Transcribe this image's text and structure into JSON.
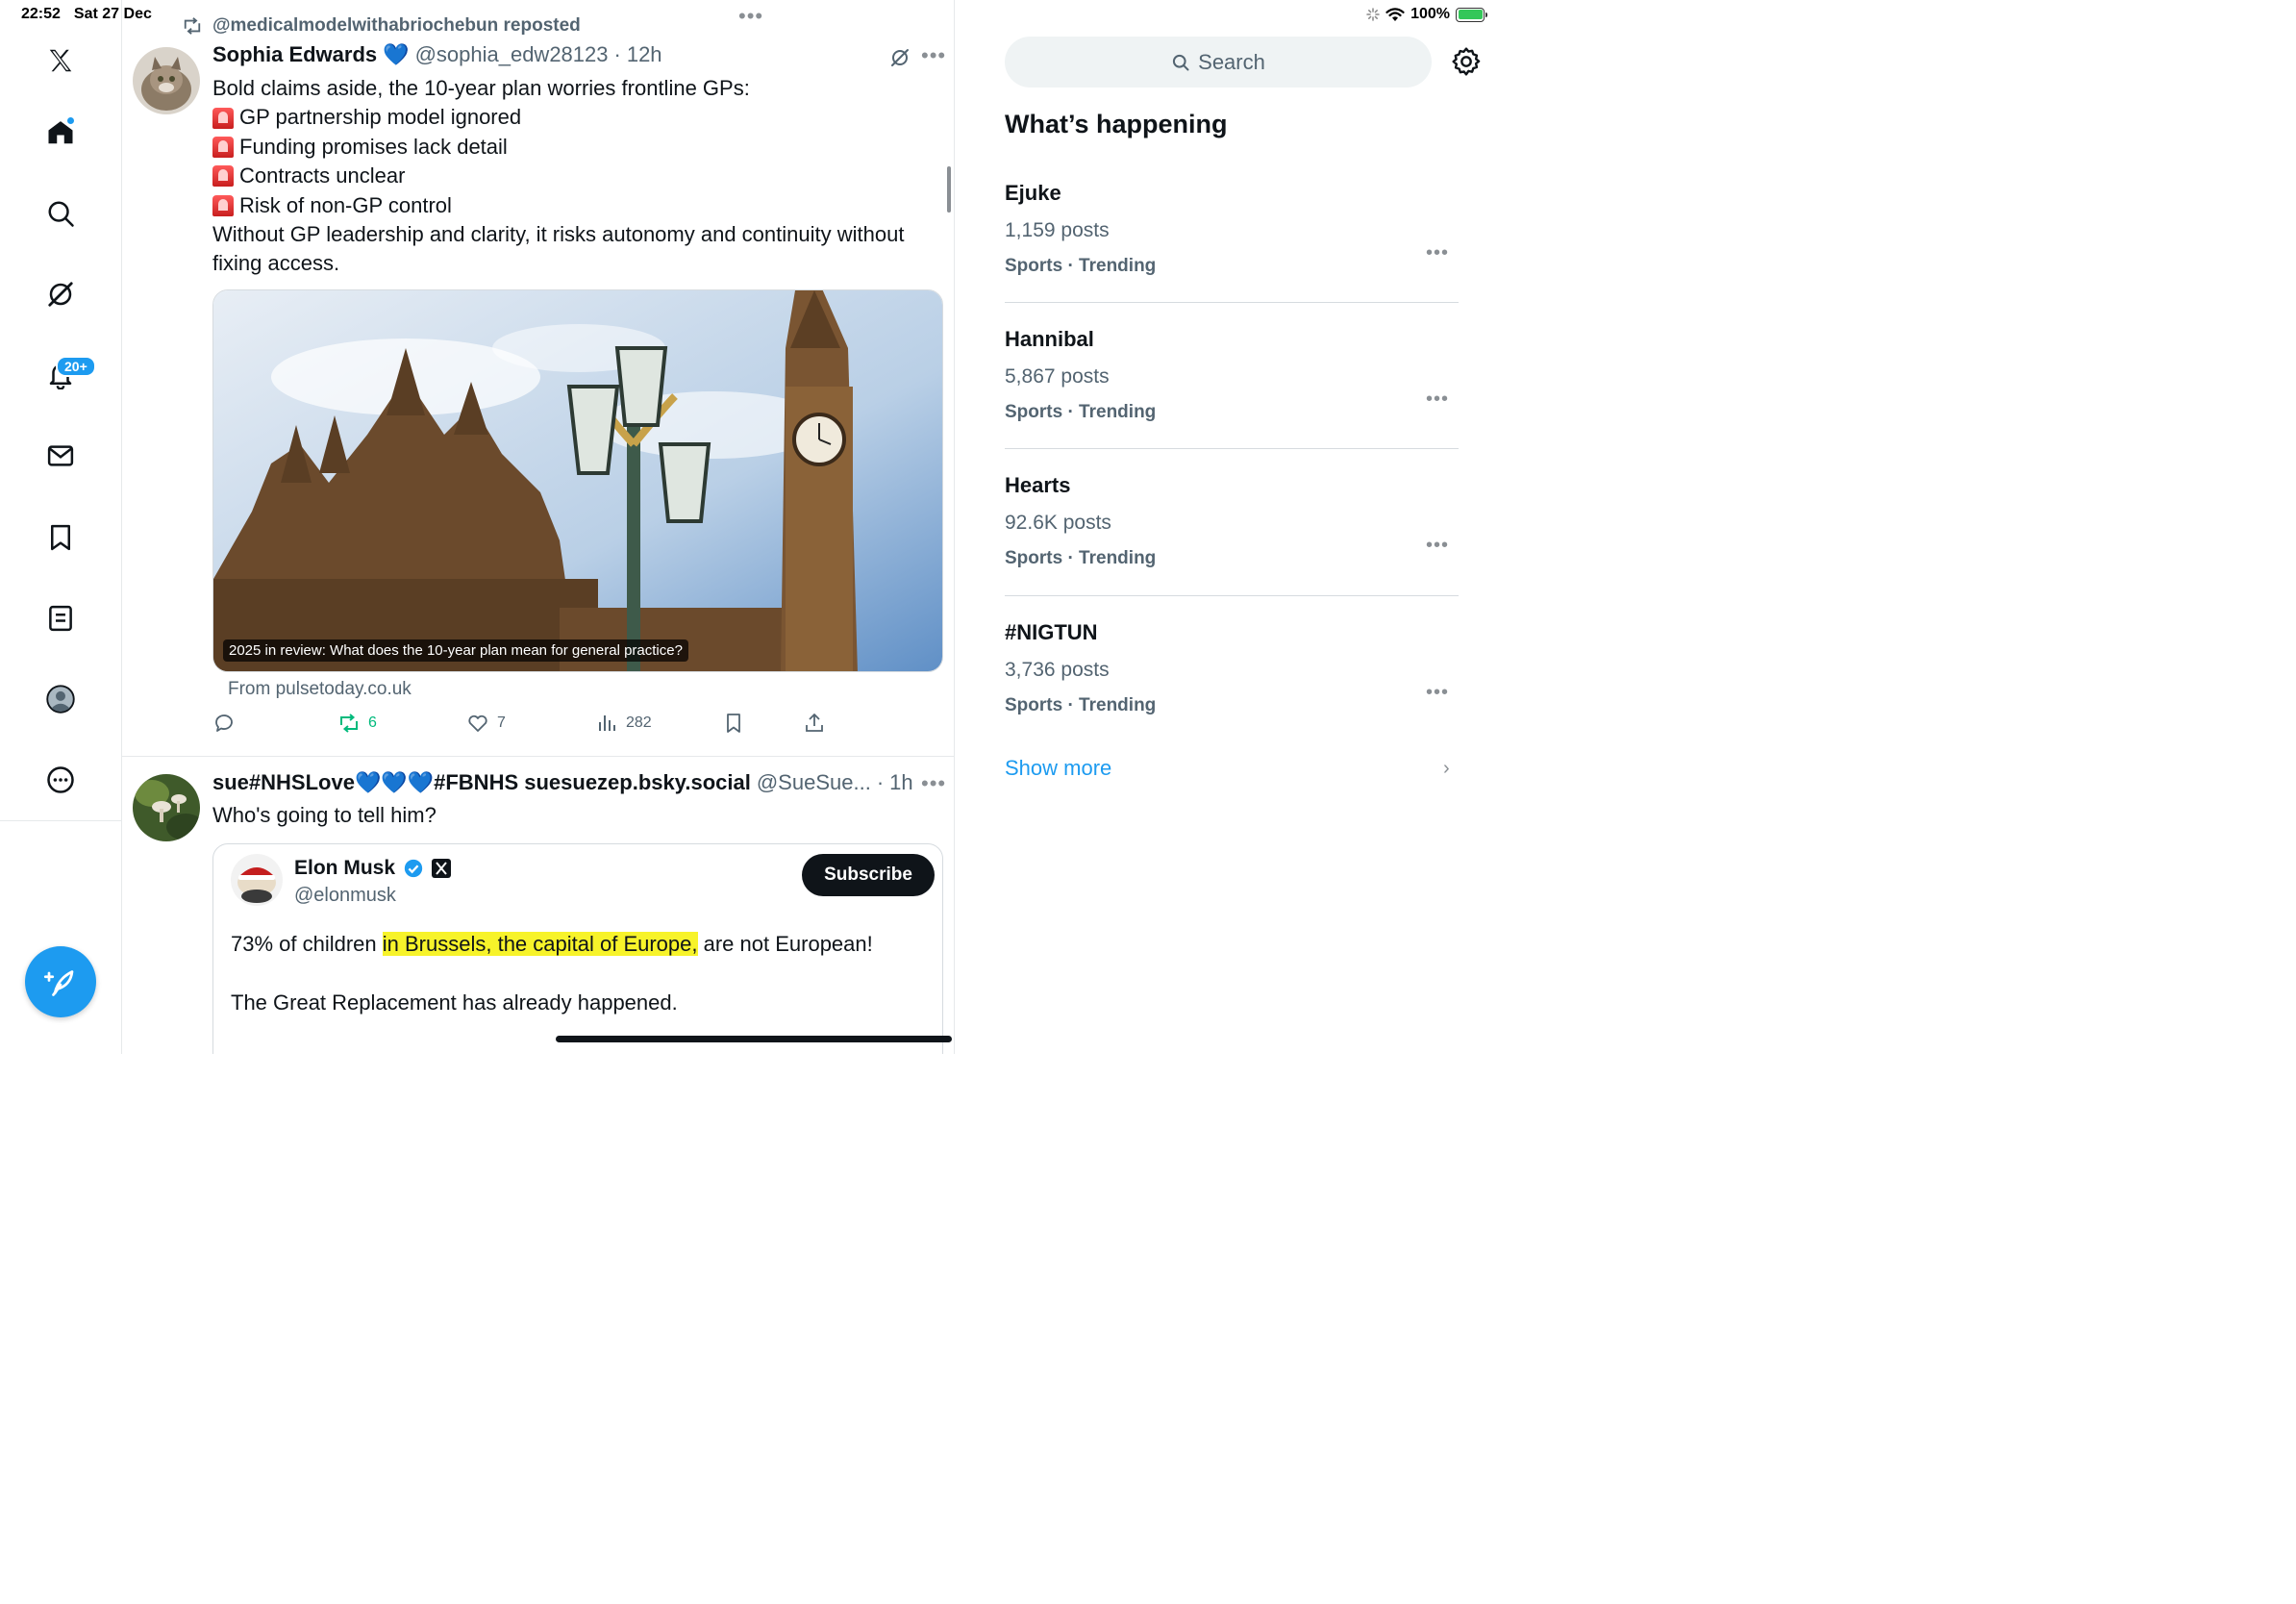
{
  "status_bar": {
    "time": "22:52",
    "date": "Sat 27 Dec",
    "battery": "100%",
    "battery_level": 1.0
  },
  "top_more": "•••",
  "nav": {
    "items": [
      {
        "name": "x-logo-icon"
      },
      {
        "name": "home-icon"
      },
      {
        "name": "search-icon"
      },
      {
        "name": "grok-icon"
      },
      {
        "name": "bell-icon"
      },
      {
        "name": "mail-icon"
      },
      {
        "name": "bookmark-icon"
      },
      {
        "name": "list-icon"
      },
      {
        "name": "profile-icon"
      },
      {
        "name": "more-circle-icon"
      }
    ],
    "notification_badge": "20+"
  },
  "feed": {
    "tweet1": {
      "repost_label": "@medicalmodelwithabriochebun reposted",
      "name": "Sophia Edwards",
      "verified_heart": "💙",
      "handle": "@sophia_edw28123",
      "sep": "·",
      "time": "12h",
      "more": "•••",
      "intro": "Bold claims aside, the 10-year plan worries frontline GPs:",
      "bullets": [
        "GP partnership model ignored",
        "Funding promises lack detail",
        "Contracts unclear",
        "Risk of non-GP control"
      ],
      "conclusion_line1": "Without GP leadership and clarity, it risks autonomy and continuity without",
      "conclusion_line2": "fixing access.",
      "media_caption": "2025 in review: What does the 10-year plan mean for general practice?",
      "from": "From pulsetoday.co.uk",
      "reposts": "6",
      "likes": "7",
      "views": "282"
    },
    "tweet2": {
      "name": "sue#NHSLove💙💙💙#FBNHS suesuezep.bsky.social",
      "handle": "@SueSue...",
      "sep": "·",
      "time": "1h",
      "more": "•••",
      "text": "Who's going to tell him?",
      "quote": {
        "name": "Elon Musk",
        "handle": "@elonmusk",
        "subscribe": "Subscribe",
        "text_before": "73% of children ",
        "text_highlight": "in Brussels, the capital of Europe,",
        "text_after": " are not European!",
        "text2": "The Great Replacement has already happened."
      }
    }
  },
  "sidebar": {
    "search_placeholder": "Search",
    "title": "What’s happening",
    "trends": [
      {
        "name": "Ejuke",
        "count": "1,159 posts",
        "category": "Sports · Trending"
      },
      {
        "name": "Hannibal",
        "count": "5,867 posts",
        "category": "Sports · Trending"
      },
      {
        "name": "Hearts",
        "count": "92.6K posts",
        "category": "Sports · Trending"
      },
      {
        "name": "#NIGTUN",
        "count": "3,736 posts",
        "category": "Sports · Trending"
      }
    ],
    "trend_more": "•••",
    "show_more": "Show more",
    "show_more_chevron": "›"
  },
  "colors": {
    "accent": "#1d9bf0",
    "text": "#0f1419",
    "muted": "#536471",
    "repost_green": "#00ba7c",
    "highlight": "#f7f32a"
  }
}
